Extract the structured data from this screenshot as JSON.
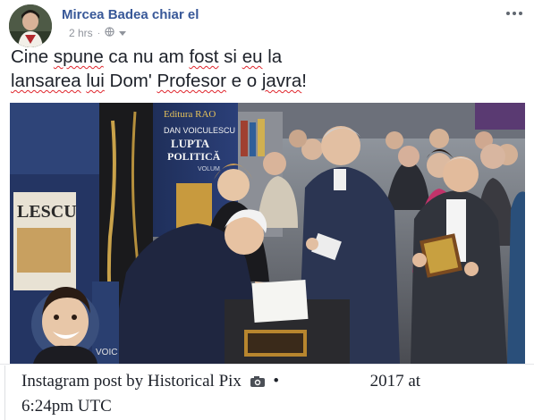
{
  "post": {
    "author": "Mircea Badea chiar el",
    "time": "2 hrs",
    "separator": "·",
    "privacy_icon": "globe-icon",
    "audience_dropdown_icon": "caret-down-icon",
    "more_icon": "more-options-icon",
    "text_line1_a": "Cine ",
    "text_line1_b": "spune",
    "text_line1_c": " ca nu am ",
    "text_line1_d": "fost",
    "text_line1_e": " si ",
    "text_line1_f": "eu",
    "text_line1_g": " la",
    "text_line2_a": "lansarea",
    "text_line2_b": " ",
    "text_line2_c": "lui",
    "text_line2_d": " Dom' ",
    "text_line2_e": "Profesor",
    "text_line2_f": " e o ",
    "text_line2_g": "javra",
    "text_line2_h": "!"
  },
  "photo": {
    "book_publisher": "Editura RAO",
    "book_author": "DAN VOICULESCU",
    "book_title_1": "LUPTA",
    "book_title_2": "POLITICĂ",
    "book_volume": "VOLUM",
    "poster_text": "LESCU",
    "book_spine_text": "VOIC"
  },
  "caption": {
    "text_before": "Instagram post by Historical Pix",
    "camera_icon": "camera-icon",
    "bullet": "•",
    "text_after": "2017 at",
    "line2": "6:24pm UTC"
  },
  "colors": {
    "author_link": "#385898",
    "meta_gray": "#90949c",
    "spellcheck": "#e0262d"
  }
}
